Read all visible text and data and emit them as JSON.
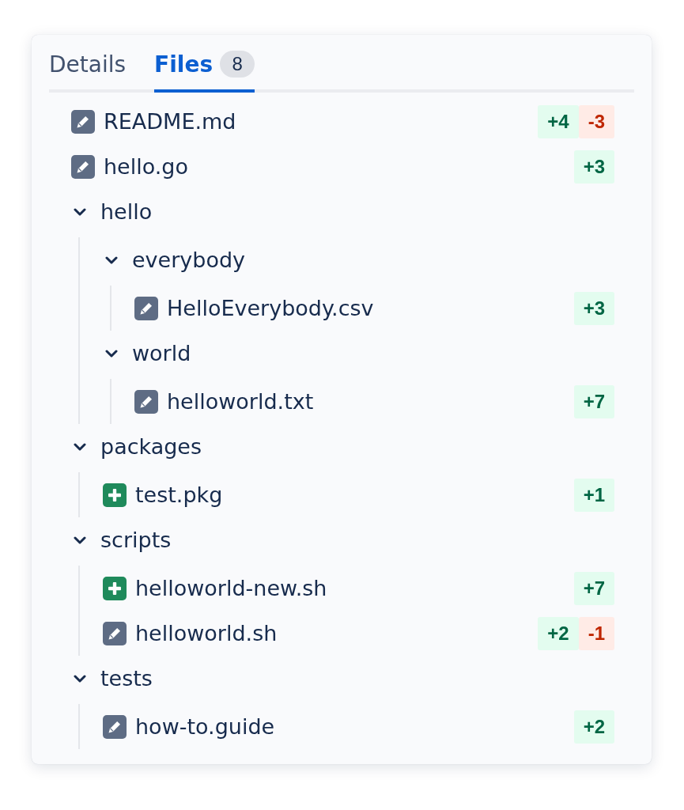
{
  "tabs": [
    {
      "label": "Details",
      "selected": false
    },
    {
      "label": "Files",
      "selected": true,
      "count": "8"
    }
  ],
  "files": [
    {
      "kind": "file",
      "name": "README.md",
      "added": false,
      "additions": "+4",
      "deletions": "-3"
    },
    {
      "kind": "file",
      "name": "hello.go",
      "added": false,
      "additions": "+3"
    },
    {
      "kind": "folder",
      "name": "hello",
      "expanded": true,
      "children": [
        {
          "kind": "folder",
          "name": "everybody",
          "expanded": true,
          "children": [
            {
              "kind": "file",
              "name": "HelloEverybody.csv",
              "added": false,
              "additions": "+3"
            }
          ]
        },
        {
          "kind": "folder",
          "name": "world",
          "expanded": true,
          "children": [
            {
              "kind": "file",
              "name": "helloworld.txt",
              "added": false,
              "additions": "+7"
            }
          ]
        }
      ]
    },
    {
      "kind": "folder",
      "name": "packages",
      "expanded": true,
      "children": [
        {
          "kind": "file",
          "name": "test.pkg",
          "added": true,
          "additions": "+1"
        }
      ]
    },
    {
      "kind": "folder",
      "name": "scripts",
      "expanded": true,
      "children": [
        {
          "kind": "file",
          "name": "helloworld-new.sh",
          "added": true,
          "additions": "+7"
        },
        {
          "kind": "file",
          "name": "helloworld.sh",
          "added": false,
          "additions": "+2",
          "deletions": "-1"
        }
      ]
    },
    {
      "kind": "folder",
      "name": "tests",
      "expanded": true,
      "children": [
        {
          "kind": "file",
          "name": "how-to.guide",
          "added": false,
          "additions": "+2"
        }
      ]
    }
  ]
}
